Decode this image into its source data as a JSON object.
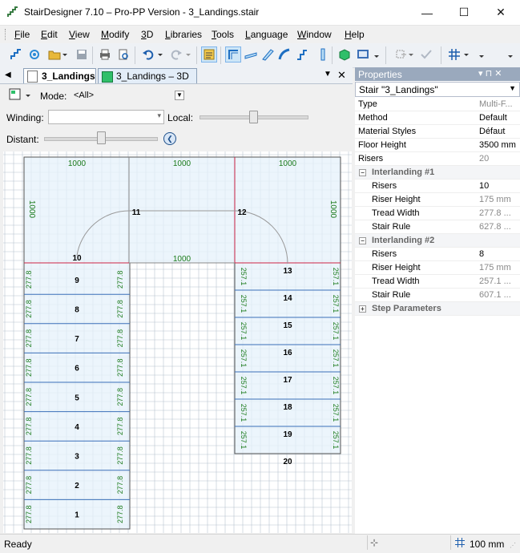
{
  "window": {
    "title": "StairDesigner 7.10 – Pro-PP Version - 3_Landings.stair",
    "min_glyph": "—",
    "max_glyph": "☐",
    "close_glyph": "✕"
  },
  "menu": [
    "File",
    "Edit",
    "View",
    "Modify",
    "3D",
    "Libraries",
    "Tools",
    "Language",
    "Window",
    "Help"
  ],
  "menu_mnemonics": [
    "F",
    "E",
    "V",
    "M",
    "3",
    "L",
    "T",
    "L",
    "W",
    "H"
  ],
  "doc_tabs": {
    "tab1": "3_Landings",
    "tab2": "3_Landings – 3D"
  },
  "options": {
    "mode_label": "Mode:",
    "mode_value": "<All>",
    "winding_label": "Winding:",
    "winding_value": "",
    "local_label": "Local:",
    "distant_label": "Distant:"
  },
  "drawing": {
    "landing_dims": [
      "1000",
      "1000",
      "1000",
      "1000",
      "1000",
      "1000"
    ],
    "left_flight_steps": [
      "1",
      "2",
      "3",
      "4",
      "5",
      "6",
      "7",
      "8",
      "9"
    ],
    "left_tread": "277.8",
    "right_flight_steps": [
      "13",
      "14",
      "15",
      "16",
      "17",
      "18",
      "19"
    ],
    "right_tread": "257.1",
    "corner_labels": [
      "10",
      "11",
      "12",
      "20"
    ]
  },
  "properties": {
    "header": "Properties",
    "pin_glyph": "▾ ⊓ ✕",
    "selector": "Stair \"3_Landings\"",
    "rows": [
      {
        "k": "Type",
        "v": "Multi-F...",
        "dim": true
      },
      {
        "k": "Method",
        "v": "Default"
      },
      {
        "k": "Material Styles",
        "v": "Défaut"
      },
      {
        "k": "Floor Height",
        "v": "3500 mm"
      },
      {
        "k": "Risers",
        "v": "20",
        "dim": true
      }
    ],
    "group1": {
      "title": "Interlanding #1",
      "rows": [
        {
          "k": "Risers",
          "v": "10"
        },
        {
          "k": "Riser Height",
          "v": "175 mm",
          "dim": true
        },
        {
          "k": "Tread Width",
          "v": "277.8 ...",
          "dim": true
        },
        {
          "k": "Stair Rule",
          "v": "627.8 ...",
          "dim": true
        }
      ]
    },
    "group2": {
      "title": "Interlanding #2",
      "rows": [
        {
          "k": "Risers",
          "v": "8"
        },
        {
          "k": "Riser Height",
          "v": "175 mm",
          "dim": true
        },
        {
          "k": "Tread Width",
          "v": "257.1 ...",
          "dim": true
        },
        {
          "k": "Stair Rule",
          "v": "607.1 ...",
          "dim": true
        }
      ]
    },
    "group3": {
      "title": "Step Parameters"
    }
  },
  "status": {
    "text": "Ready",
    "grid": "100 mm"
  },
  "colors": {
    "accent": "#3399ff",
    "dim_text": "#1a7a1a",
    "stair_fill": "#e6f2fb",
    "red_line": "#cc2244",
    "grid": "#b8c4d0"
  }
}
